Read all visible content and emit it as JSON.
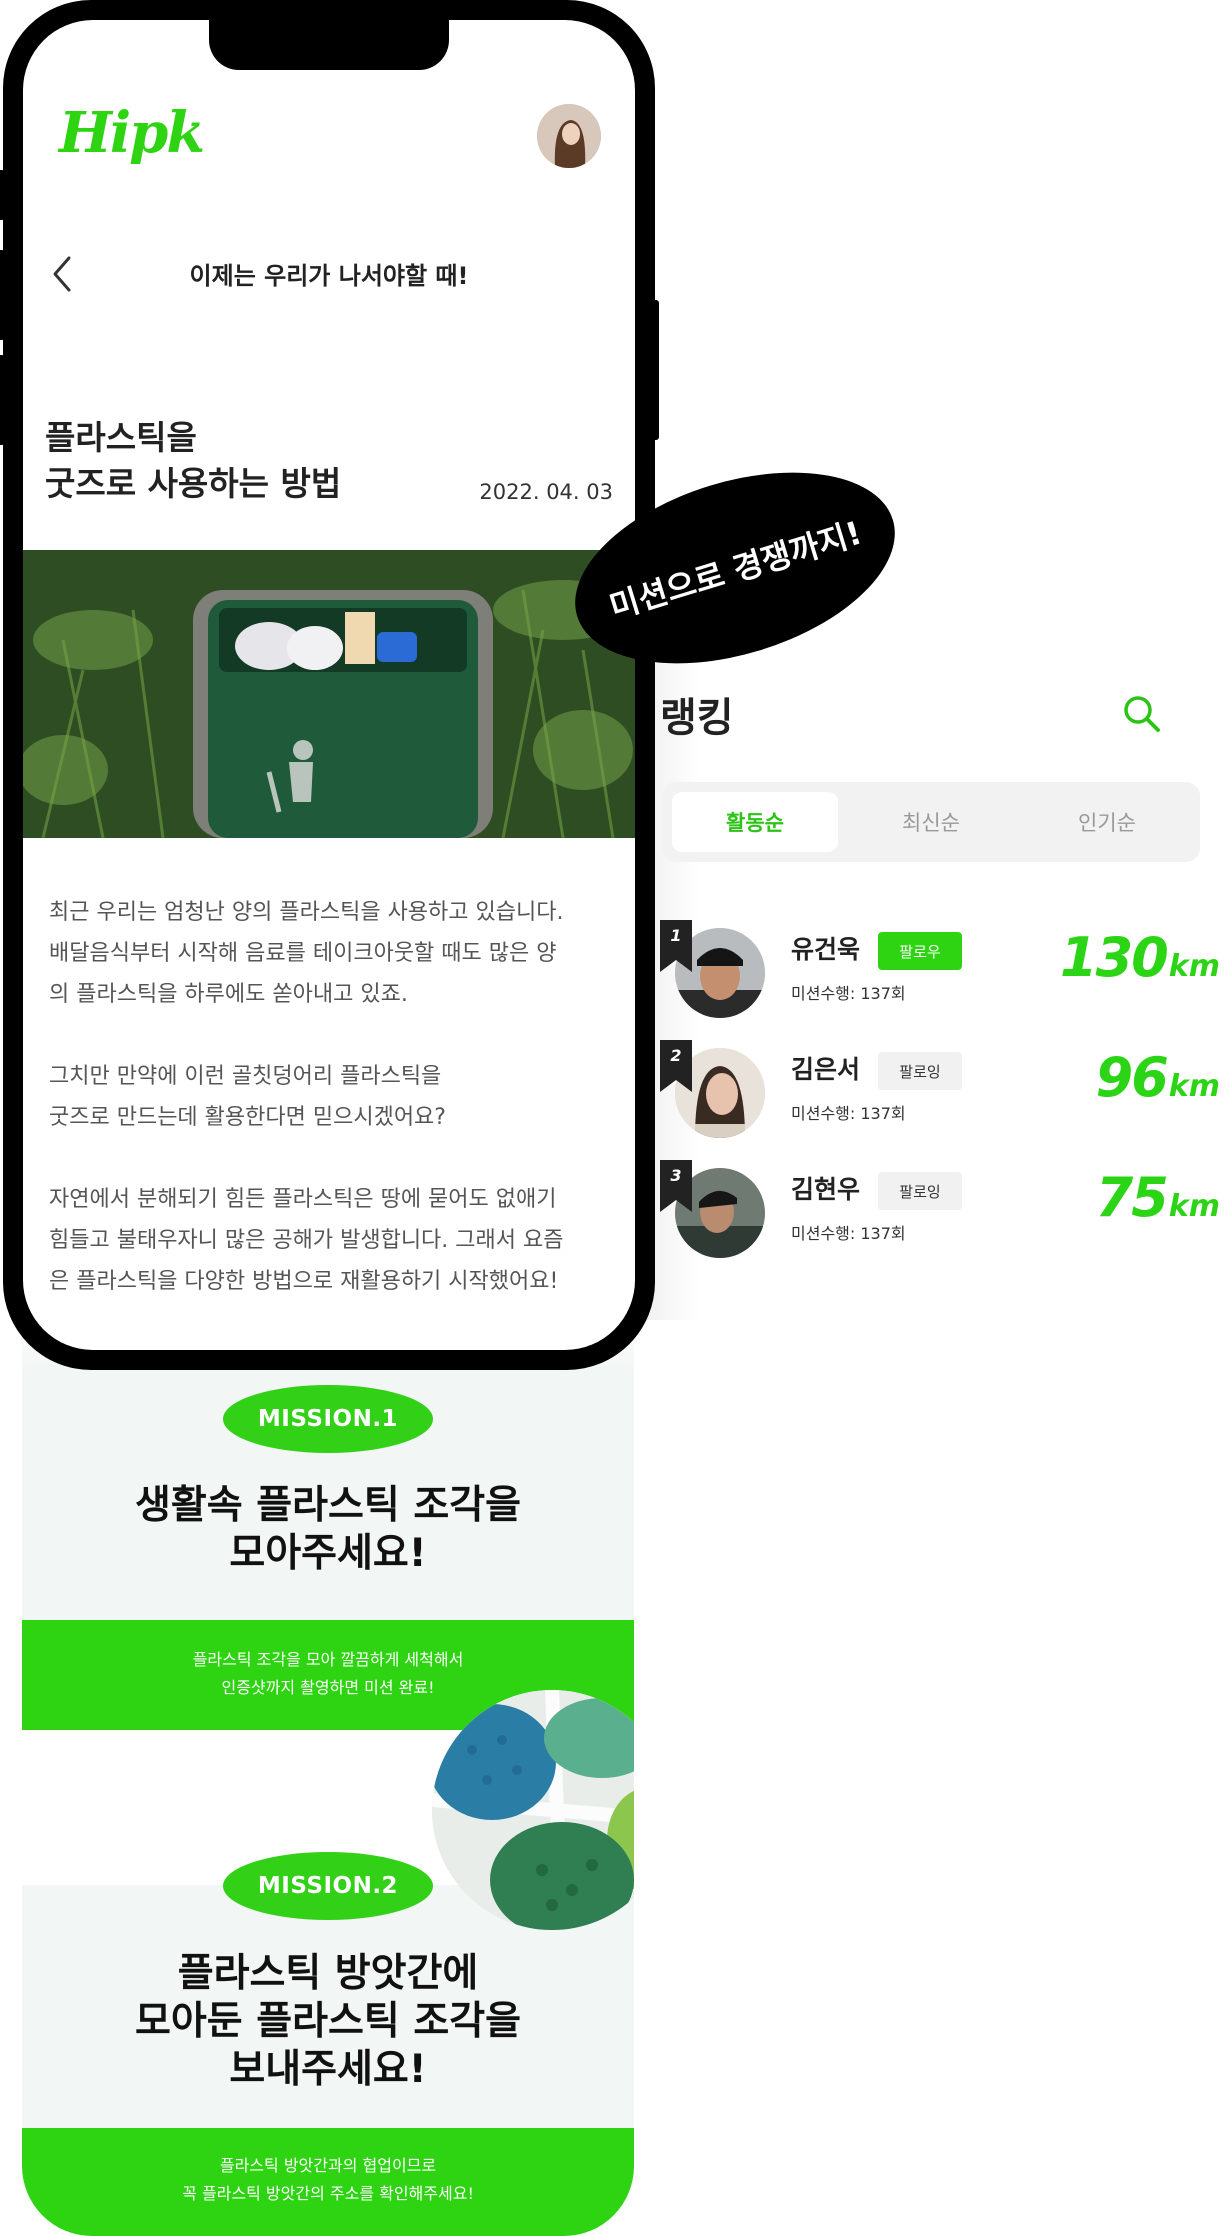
{
  "app": {
    "logo": "Hipk",
    "header_title": "이제는 우리가 나서야할 때!"
  },
  "article": {
    "title_lines": [
      "플라스틱을",
      "굿즈로 사용하는 방법"
    ],
    "date": "2022. 04. 03",
    "paragraphs": [
      [
        "최근 우리는 엄청난 양의 플라스틱을 사용하고 있습니다.",
        "배달음식부터 시작해 음료를 테이크아웃할 때도 많은 양",
        "의 플라스틱을 하루에도 쏟아내고 있죠."
      ],
      [
        "그치만 만약에 이런 골칫덩어리 플라스틱을",
        "굿즈로 만드는데 활용한다면 믿으시겠어요?"
      ],
      [
        "자연에서 분해되기 힘든 플라스틱은 땅에 묻어도 없애기",
        "힘들고 불태우자니 많은 공해가 발생합니다. 그래서 요즘",
        "은 플라스틱을 다양한 방법으로 재활용하기 시작했어요!"
      ]
    ]
  },
  "badge": "미션으로 경쟁까지!",
  "ranking": {
    "title": "랭킹",
    "tabs": [
      {
        "label": "활동순",
        "active": true
      },
      {
        "label": "최신순",
        "active": false
      },
      {
        "label": "인기순",
        "active": false
      }
    ],
    "entries": [
      {
        "rank": "1",
        "name": "유건욱",
        "follow_label": "팔로우",
        "following": false,
        "missions": "미션수행: 137회",
        "distance": "130",
        "unit": "km"
      },
      {
        "rank": "2",
        "name": "김은서",
        "follow_label": "팔로잉",
        "following": true,
        "missions": "미션수행: 137회",
        "distance": "96",
        "unit": "km"
      },
      {
        "rank": "3",
        "name": "김현우",
        "follow_label": "팔로잉",
        "following": true,
        "missions": "미션수행: 137회",
        "distance": "75",
        "unit": "km"
      }
    ]
  },
  "missions": [
    {
      "label": "MISSION.1",
      "title_lines": [
        "생활속 플라스틱 조각을",
        "모아주세요!"
      ],
      "desc_lines": [
        "플라스틱 조각을 모아 깔끔하게 세척해서",
        "인증샷까지 촬영하면 미션 완료!"
      ]
    },
    {
      "label": "MISSION.2",
      "title_lines": [
        "플라스틱 방앗간에",
        "모아둔 플라스틱 조각을",
        "보내주세요!"
      ],
      "desc_lines": [
        "플라스틱 방앗간과의 협업이므로",
        "꼭 플라스틱 방앗간의 주소를 확인해주세요!"
      ]
    }
  ],
  "colors": {
    "accent": "#2ED412",
    "dark": "#000000",
    "muted_bg": "#F2F6F5"
  },
  "icons": [
    "back-chevron-icon",
    "search-icon",
    "rank-ribbon-icon"
  ]
}
